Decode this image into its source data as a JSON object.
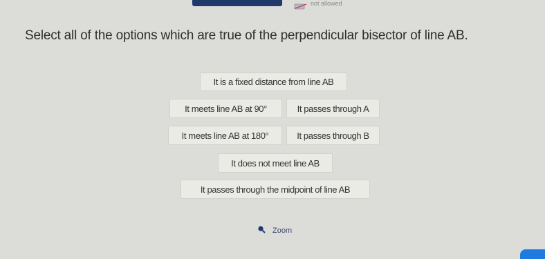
{
  "header": {
    "note_label": "not allowed"
  },
  "question": {
    "text": "Select all of the options which are true of the perpendicular bisector of line AB."
  },
  "options": [
    {
      "label": "It is a fixed distance from line AB"
    },
    {
      "label": "It meets line AB at 90°"
    },
    {
      "label": "It passes through A"
    },
    {
      "label": "It meets line AB at 180°"
    },
    {
      "label": "It passes through B"
    },
    {
      "label": "It does not meet line AB"
    },
    {
      "label": "It passes through the midpoint of line AB"
    }
  ],
  "zoom": {
    "label": "Zoom",
    "icon": "search-icon"
  },
  "colors": {
    "background": "#dcdcd8",
    "option_bg": "#ebebe6",
    "header_bar": "#1f3a6a",
    "accent": "#1f7be0"
  }
}
